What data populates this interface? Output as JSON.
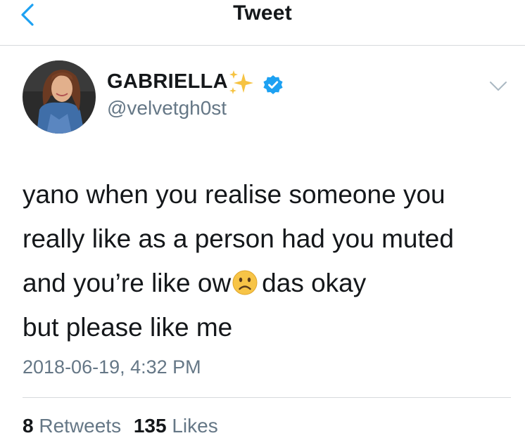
{
  "header": {
    "title": "Tweet",
    "back_icon": "chevron-left-icon",
    "accent_color": "#1da1f2"
  },
  "author": {
    "display_name": "GABRIELLA",
    "handle": "@velvetgh0st",
    "name_icons": [
      "sparkles-icon",
      "verified-badge-icon"
    ],
    "menu_icon": "chevron-down-icon"
  },
  "tweet": {
    "lines": [
      "yano when you realise someone you",
      "really like as a person had you muted",
      "and you’re like ow",
      "das okay",
      "but please like me"
    ],
    "emoji": "frowning-face-icon",
    "timestamp": "2018-06-19, 4:32 PM"
  },
  "stats": {
    "retweets_count": "8",
    "retweets_label": "Retweets",
    "likes_count": "135",
    "likes_label": "Likes"
  },
  "colors": {
    "text": "#14171a",
    "secondary": "#657786",
    "verified": "#1da1f2",
    "divider": "#d6d9dc"
  }
}
